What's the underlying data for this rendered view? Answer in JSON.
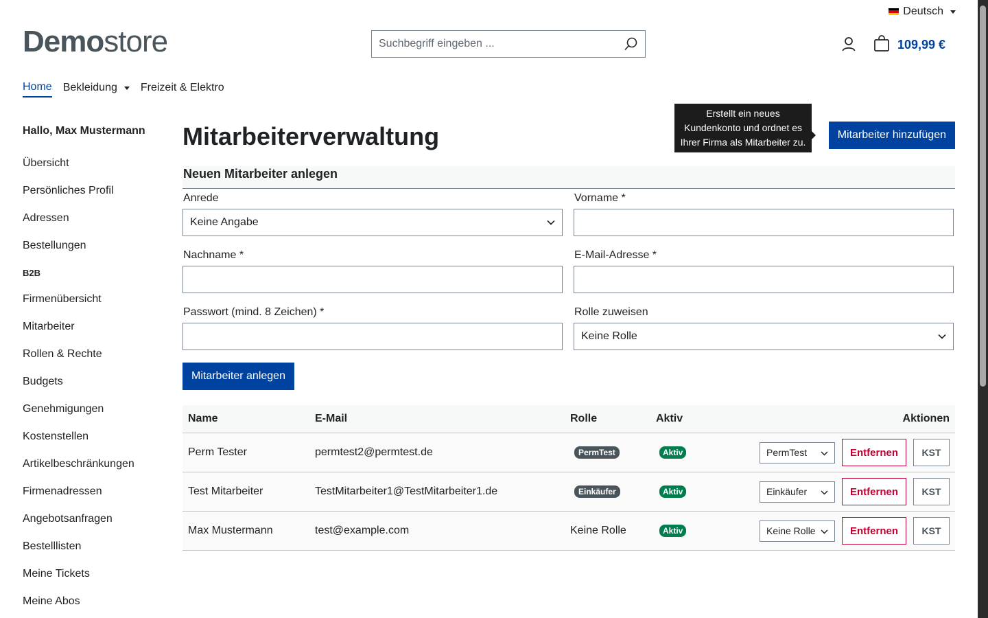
{
  "header": {
    "language": "Deutsch",
    "logo_bold": "Demo",
    "logo_light": "store",
    "search_placeholder": "Suchbegriff eingeben ...",
    "cart_total": "109,99 €"
  },
  "nav": {
    "items": [
      "Home",
      "Bekleidung",
      "Freizeit & Elektro"
    ]
  },
  "sidebar": {
    "greeting": "Hallo, Max Mustermann",
    "items": [
      "Übersicht",
      "Persönliches Profil",
      "Adressen",
      "Bestellungen"
    ],
    "section": "B2B",
    "b2b_items": [
      "Firmenübersicht",
      "Mitarbeiter",
      "Rollen & Rechte",
      "Budgets",
      "Genehmigungen",
      "Kostenstellen",
      "Artikelbeschränkungen",
      "Firmenadressen",
      "Angebotsanfragen",
      "Bestelllisten",
      "Meine Tickets",
      "Meine Abos"
    ]
  },
  "main": {
    "title": "Mitarbeiterverwaltung",
    "add_button": "Mitarbeiter hinzufügen",
    "tooltip": "Erstellt ein neues Kundenkonto und ordnet es Ihrer Firma als Mitarbeiter zu.",
    "form": {
      "heading": "Neuen Mitarbeiter anlegen",
      "salutation_label": "Anrede",
      "salutation_value": "Keine Angabe",
      "firstname_label": "Vorname *",
      "lastname_label": "Nachname *",
      "email_label": "E-Mail-Adresse *",
      "password_label": "Passwort (mind. 8 Zeichen) *",
      "role_label": "Rolle zuweisen",
      "role_value": "Keine Rolle",
      "submit": "Mitarbeiter anlegen"
    },
    "table": {
      "headers": [
        "Name",
        "E-Mail",
        "Rolle",
        "Aktiv",
        "Aktionen"
      ],
      "rows": [
        {
          "name": "Perm Tester",
          "email": "permtest2@permtest.de",
          "role": "PermTest",
          "active": "Aktiv",
          "select": "PermTest",
          "remove": "Entfernen",
          "kst": "KST"
        },
        {
          "name": "Test Mitarbeiter",
          "email": "TestMitarbeiter1@TestMitarbeiter1.de",
          "role": "Einkäufer",
          "active": "Aktiv",
          "select": "Einkäufer",
          "remove": "Entfernen",
          "kst": "KST"
        },
        {
          "name": "Max Mustermann",
          "email": "test@example.com",
          "role": "Keine Rolle",
          "active": "Aktiv",
          "select": "Keine Rolle",
          "remove": "Entfernen",
          "kst": "KST"
        }
      ]
    }
  },
  "colors": {
    "primary": "#0042a0",
    "danger": "#c2002f",
    "success": "#007e4e",
    "badge_dark": "#4a545b"
  }
}
